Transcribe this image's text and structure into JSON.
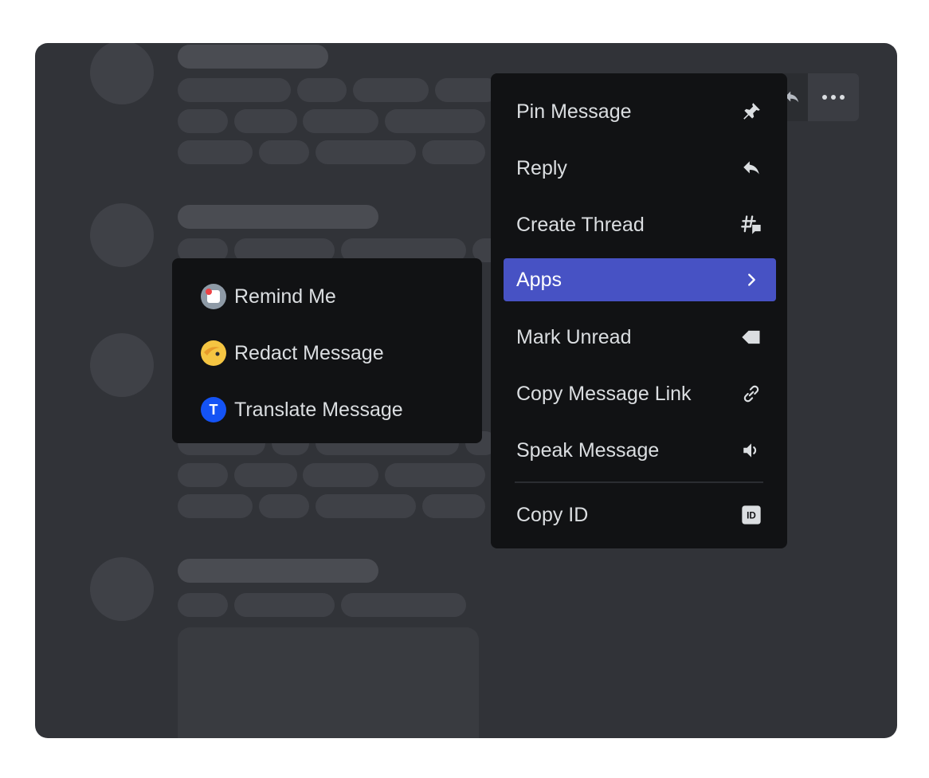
{
  "context_menu": {
    "items": [
      {
        "label": "Pin Message",
        "icon": "pin-icon"
      },
      {
        "label": "Reply",
        "icon": "reply-icon"
      },
      {
        "label": "Create Thread",
        "icon": "thread-icon"
      },
      {
        "label": "Apps",
        "icon": "chevron-right-icon",
        "active": true
      },
      {
        "label": "Mark Unread",
        "icon": "mark-unread-icon"
      },
      {
        "label": "Copy Message Link",
        "icon": "link-icon"
      },
      {
        "label": "Speak Message",
        "icon": "speaker-icon"
      },
      {
        "label": "Copy ID",
        "icon": "id-icon"
      }
    ]
  },
  "apps_submenu": {
    "items": [
      {
        "label": "Remind Me",
        "icon": "remind-me-app-icon"
      },
      {
        "label": "Redact Message",
        "icon": "redact-message-app-icon"
      },
      {
        "label": "Translate Message",
        "icon": "translate-message-app-icon",
        "icon_letter": "T"
      }
    ]
  },
  "colors": {
    "panel_bg": "#313338",
    "menu_bg": "#111214",
    "accent": "#4752c4",
    "text": "#dbdee1"
  }
}
